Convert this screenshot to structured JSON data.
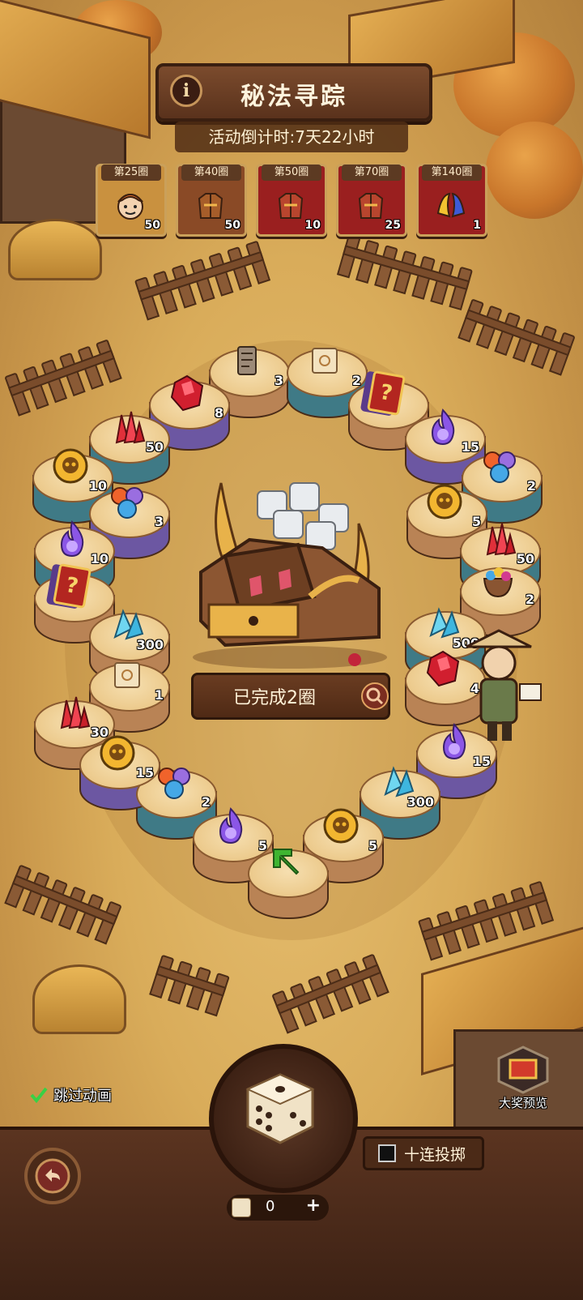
{
  "header": {
    "title": "秘法寻踪",
    "info_icon": "i",
    "countdown": "活动倒计时:7天22小时"
  },
  "milestones": [
    {
      "label": "第25圈",
      "count": "50",
      "reward": "hero-portrait",
      "frame": "#c9913f"
    },
    {
      "label": "第40圈",
      "count": "50",
      "reward": "armor-chest",
      "frame": "#8a4a26"
    },
    {
      "label": "第50圈",
      "count": "10",
      "reward": "armor-chest-red",
      "frame": "#9a1f1f"
    },
    {
      "label": "第70圈",
      "count": "25",
      "reward": "armor-chest-red",
      "frame": "#9a1f1f"
    },
    {
      "label": "第140圈",
      "count": "1",
      "reward": "wing-pets",
      "frame": "#9a1f1f"
    }
  ],
  "board_tiles": [
    {
      "icon": "scroll-icon",
      "count": "3"
    },
    {
      "icon": "map-scroll-icon",
      "count": "2"
    },
    {
      "icon": "mystery-card-icon",
      "count": ""
    },
    {
      "icon": "purple-flame-icon",
      "count": "15"
    },
    {
      "icon": "element-orbs-icon",
      "count": "2"
    },
    {
      "icon": "skull-coin-icon",
      "count": "5"
    },
    {
      "icon": "red-crystal-icon",
      "count": "50"
    },
    {
      "icon": "gem-bag-icon",
      "count": "2"
    },
    {
      "icon": "blue-crystal-icon",
      "count": "500"
    },
    {
      "icon": "red-gem-icon",
      "count": "4"
    },
    {
      "icon": "purple-flame-icon",
      "count": "15"
    },
    {
      "icon": "blue-crystal-icon",
      "count": "300"
    },
    {
      "icon": "skull-coin-icon",
      "count": "5"
    },
    {
      "icon": "start-arrow-icon",
      "count": ""
    },
    {
      "icon": "purple-flame-icon",
      "count": "5"
    },
    {
      "icon": "element-orbs-icon",
      "count": "2"
    },
    {
      "icon": "skull-coin-icon",
      "count": "15"
    },
    {
      "icon": "red-crystal-icon",
      "count": "30"
    },
    {
      "icon": "map-scroll-icon",
      "count": "1"
    },
    {
      "icon": "blue-crystal-icon",
      "count": "300"
    },
    {
      "icon": "mystery-card-icon",
      "count": ""
    },
    {
      "icon": "purple-flame-icon",
      "count": "10"
    },
    {
      "icon": "element-orbs-icon",
      "count": "3"
    },
    {
      "icon": "skull-coin-icon",
      "count": "10"
    },
    {
      "icon": "red-crystal-icon",
      "count": "50"
    },
    {
      "icon": "red-gem-icon",
      "count": "8"
    }
  ],
  "center": {
    "progress_text": "已完成2圈",
    "zoom_icon": "search-icon"
  },
  "controls": {
    "skip_animation": "跳过动画",
    "skip_checked": true,
    "grand_prize_preview": "大奖预览",
    "ten_roll": "十连投掷",
    "ten_roll_checked": false,
    "dice_count": "0",
    "plus": "+"
  },
  "colors": {
    "accent": "#5a321c",
    "text_light": "#fff4dd",
    "tile_teal": "#3f7a86",
    "tile_purple": "#6c57a2",
    "tile_wood": "#b98355"
  }
}
